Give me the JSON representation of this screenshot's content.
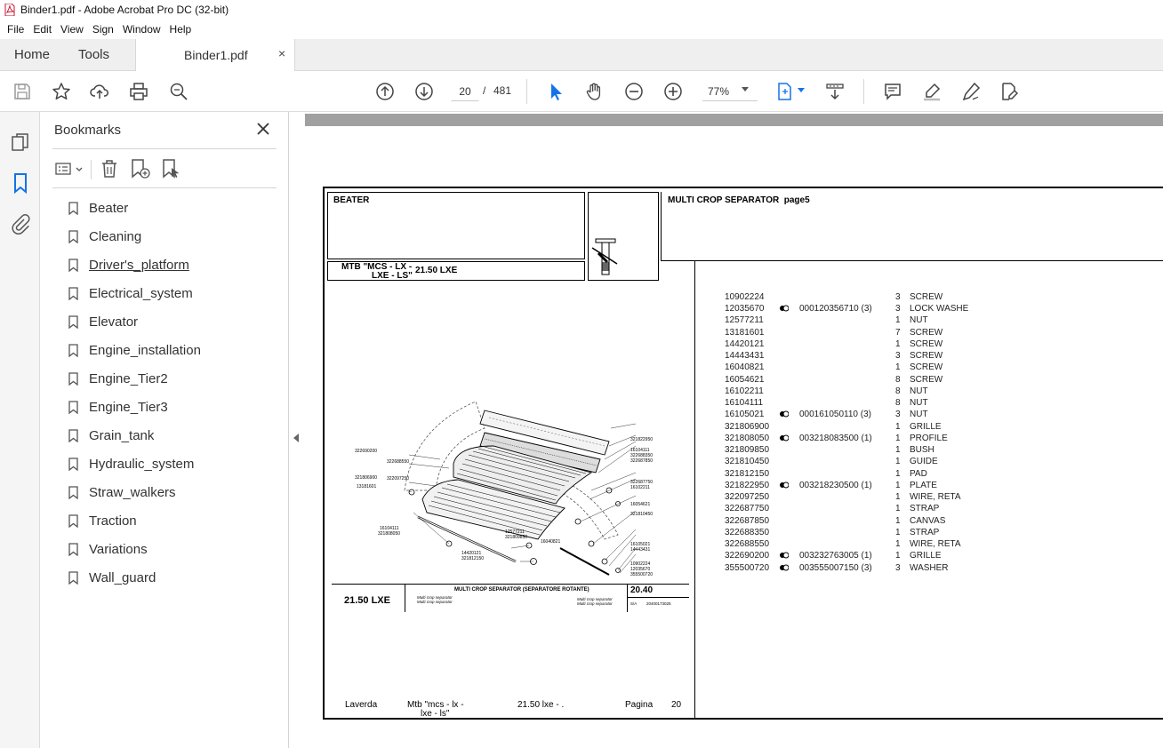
{
  "window": {
    "title": "Binder1.pdf - Adobe Acrobat Pro DC (32-bit)"
  },
  "menu": [
    "File",
    "Edit",
    "View",
    "Sign",
    "Window",
    "Help"
  ],
  "tabs": {
    "home": "Home",
    "tools": "Tools",
    "document": "Binder1.pdf",
    "close": "×"
  },
  "toolbar": {
    "current_page": "20",
    "page_sep": "/",
    "total_pages": "481",
    "zoom": "77%"
  },
  "bookmarks": {
    "header": "Bookmarks",
    "items": [
      {
        "label": "Beater"
      },
      {
        "label": "Cleaning"
      },
      {
        "label": "Driver's_platform"
      },
      {
        "label": "Electrical_system"
      },
      {
        "label": "Elevator"
      },
      {
        "label": "Engine_installation"
      },
      {
        "label": "Engine_Tier2"
      },
      {
        "label": "Engine_Tier3"
      },
      {
        "label": "Grain_tank"
      },
      {
        "label": "Hydraulic_system"
      },
      {
        "label": "Straw_walkers"
      },
      {
        "label": "Traction"
      },
      {
        "label": "Variations"
      },
      {
        "label": "Wall_guard"
      }
    ]
  },
  "document": {
    "section": "BEATER",
    "header_title": "MULTI CROP SEPARATOR  page5",
    "model_line1": "MTB \"MCS - LX -",
    "model_line2": "LXE - LS\"",
    "model_code": "21.50 LXE",
    "drawing": {
      "model": "21.50 LXE",
      "caption": "MULTI CROP SEPARATOR (SEPARATORE ROTANTE)",
      "sub1": "Multi crop separator",
      "sub2": "Multi crop separator",
      "sub3": "Multi crop separator",
      "sub4": "Multi crop separator",
      "table_no": "20.40",
      "sa": "S/A",
      "ref": "20400173025",
      "callouts": {
        "c1": "321822950",
        "c2": "16104111",
        "c3": "322688350",
        "c4": "322687850",
        "c5": "322690200",
        "c6": "322688550",
        "c7": "322687750",
        "c8": "16102211",
        "c9": "321806900",
        "c10": "322097250",
        "c11": "13181601",
        "c12": "16054621",
        "c13": "321810450",
        "c14": "12577211",
        "c15": "321809850",
        "c16": "16040821",
        "c17": "16104111",
        "c18": "321808050",
        "c19": "16105021",
        "c20": "14443431",
        "c21": "14420121",
        "c22": "321812150",
        "c23": "10902224",
        "c24": "12035670",
        "c25": "355500720"
      }
    },
    "footer": {
      "brand": "Laverda",
      "model_a": "Mtb \"mcs - lx -",
      "model_b": "lxe - ls\"",
      "code": "21.50 lxe - .",
      "page_label": "Pagina",
      "page_no": "20"
    },
    "parts": [
      {
        "code": "10902224",
        "alt": "",
        "qty": "3",
        "desc": "SCREW",
        "icon": false
      },
      {
        "code": "12035670",
        "alt": "000120356710  (3)",
        "qty": "3",
        "desc": "LOCK WASHE",
        "icon": true
      },
      {
        "code": "12577211",
        "alt": "",
        "qty": "1",
        "desc": "NUT",
        "icon": false
      },
      {
        "code": "13181601",
        "alt": "",
        "qty": "7",
        "desc": "SCREW",
        "icon": false
      },
      {
        "code": "14420121",
        "alt": "",
        "qty": "1",
        "desc": "SCREW",
        "icon": false
      },
      {
        "code": "14443431",
        "alt": "",
        "qty": "3",
        "desc": "SCREW",
        "icon": false
      },
      {
        "code": "16040821",
        "alt": "",
        "qty": "1",
        "desc": "SCREW",
        "icon": false
      },
      {
        "code": "16054621",
        "alt": "",
        "qty": "8",
        "desc": "SCREW",
        "icon": false
      },
      {
        "code": "16102211",
        "alt": "",
        "qty": "8",
        "desc": "NUT",
        "icon": false
      },
      {
        "code": "16104111",
        "alt": "",
        "qty": "8",
        "desc": "NUT",
        "icon": false
      },
      {
        "code": "16105021",
        "alt": "000161050110  (3)",
        "qty": "3",
        "desc": "NUT",
        "icon": true
      },
      {
        "code": "321806900",
        "alt": "",
        "qty": "1",
        "desc": "GRILLE",
        "icon": false
      },
      {
        "code": "321808050",
        "alt": "003218083500  (1)",
        "qty": "1",
        "desc": "PROFILE",
        "icon": true
      },
      {
        "code": "321809850",
        "alt": "",
        "qty": "1",
        "desc": "BUSH",
        "icon": false
      },
      {
        "code": "321810450",
        "alt": "",
        "qty": "1",
        "desc": "GUIDE",
        "icon": false
      },
      {
        "code": "321812150",
        "alt": "",
        "qty": "1",
        "desc": "PAD",
        "icon": false
      },
      {
        "code": "321822950",
        "alt": "003218230500  (1)",
        "qty": "1",
        "desc": "PLATE",
        "icon": true
      },
      {
        "code": "322097250",
        "alt": "",
        "qty": "1",
        "desc": "WIRE, RETA",
        "icon": false
      },
      {
        "code": "322687750",
        "alt": "",
        "qty": "1",
        "desc": "STRAP",
        "icon": false
      },
      {
        "code": "322687850",
        "alt": "",
        "qty": "1",
        "desc": "CANVAS",
        "icon": false
      },
      {
        "code": "322688350",
        "alt": "",
        "qty": "1",
        "desc": "STRAP",
        "icon": false
      },
      {
        "code": "322688550",
        "alt": "",
        "qty": "1",
        "desc": "WIRE, RETA",
        "icon": false
      },
      {
        "code": "322690200",
        "alt": "003232763005  (1)",
        "qty": "1",
        "desc": "GRILLE",
        "icon": true
      },
      {
        "code": "355500720",
        "alt": "003555007150  (3)",
        "qty": "3",
        "desc": "WASHER",
        "icon": true
      }
    ]
  }
}
